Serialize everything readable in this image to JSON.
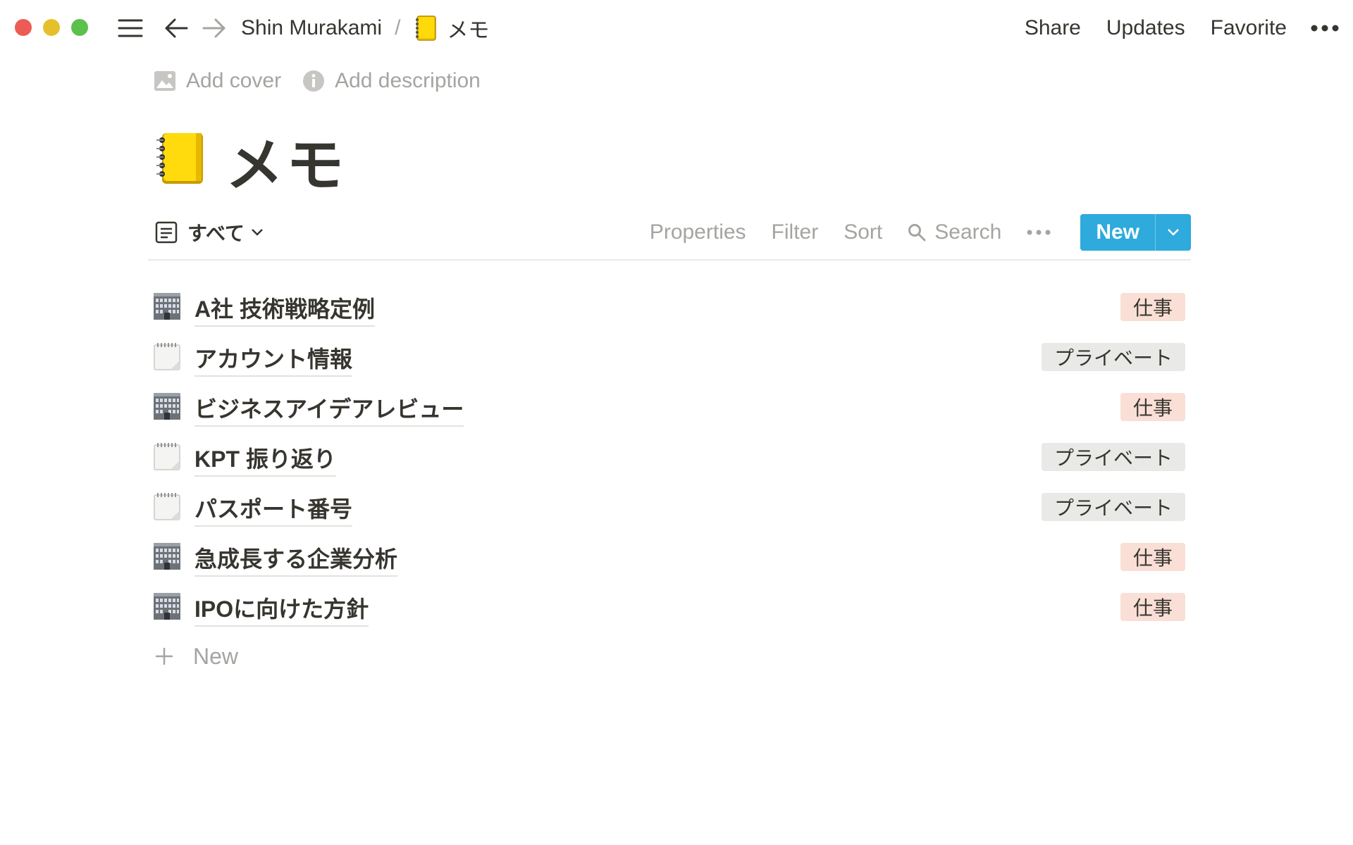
{
  "titlebar": {
    "breadcrumb_workspace": "Shin Murakami",
    "breadcrumb_separator": "/",
    "breadcrumb_page": "メモ",
    "share_label": "Share",
    "updates_label": "Updates",
    "favorite_label": "Favorite"
  },
  "page": {
    "add_cover_label": "Add cover",
    "add_description_label": "Add description",
    "title": "メモ"
  },
  "view": {
    "name": "すべて",
    "properties_label": "Properties",
    "filter_label": "Filter",
    "sort_label": "Sort",
    "search_label": "Search",
    "new_label": "New"
  },
  "rows": [
    {
      "icon": "office-building-icon",
      "title": "A社 技術戦略定例",
      "tag": "仕事",
      "tag_type": "work"
    },
    {
      "icon": "spiral-notepad-icon",
      "title": "アカウント情報",
      "tag": "プライベート",
      "tag_type": "private"
    },
    {
      "icon": "office-building-icon",
      "title": "ビジネスアイデアレビュー",
      "tag": "仕事",
      "tag_type": "work"
    },
    {
      "icon": "spiral-notepad-icon",
      "title": "KPT 振り返り",
      "tag": "プライベート",
      "tag_type": "private"
    },
    {
      "icon": "spiral-notepad-icon",
      "title": "パスポート番号",
      "tag": "プライベート",
      "tag_type": "private"
    },
    {
      "icon": "office-building-icon",
      "title": "急成長する企業分析",
      "tag": "仕事",
      "tag_type": "work"
    },
    {
      "icon": "office-building-icon",
      "title": "IPOに向けた方針",
      "tag": "仕事",
      "tag_type": "work"
    }
  ],
  "add_row_label": "New",
  "colors": {
    "accent": "#2eaadc",
    "tag_work_bg": "#fadfd6",
    "tag_private_bg": "#e9e9e7",
    "text": "#37352f",
    "muted": "#a5a4a0"
  }
}
